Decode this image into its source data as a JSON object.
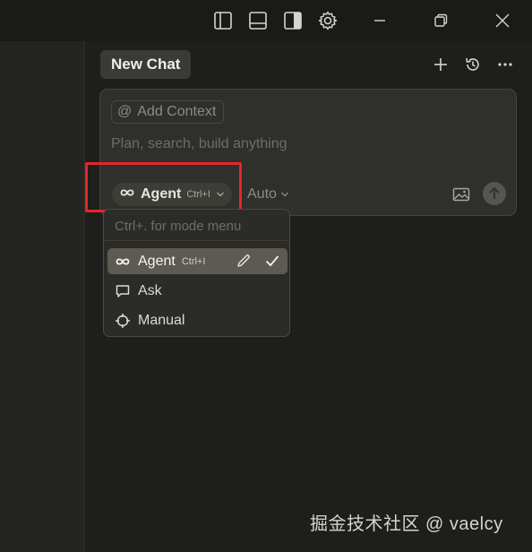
{
  "titlebar": {
    "icons": [
      "toggle-primary-sidebar-icon",
      "toggle-panel-icon",
      "toggle-secondary-sidebar-icon",
      "settings-gear-icon",
      "minimize-icon",
      "restore-icon",
      "close-icon"
    ]
  },
  "header": {
    "tab_label": "New Chat",
    "icons": [
      "plus-icon",
      "history-icon",
      "more-icon"
    ]
  },
  "composer": {
    "add_context_label": "Add Context",
    "add_context_symbol": "@",
    "placeholder": "Plan, search, build anything",
    "mode_label": "Agent",
    "mode_shortcut": "Ctrl+I",
    "model_label": "Auto"
  },
  "mode_menu": {
    "hint": "Ctrl+. for mode menu",
    "items": [
      {
        "label": "Agent",
        "shortcut": "Ctrl+I",
        "icon": "infinity-icon",
        "selected": true
      },
      {
        "label": "Ask",
        "icon": "chat-bubble-icon",
        "selected": false
      },
      {
        "label": "Manual",
        "icon": "crosshair-icon",
        "selected": false
      }
    ]
  },
  "watermark": "掘金技术社区 @ vaelcy",
  "colors": {
    "background": "#1e1e1d",
    "card": "#2f2f2b",
    "selected_item": "#5c5a52",
    "highlight_border": "#e3262a"
  }
}
